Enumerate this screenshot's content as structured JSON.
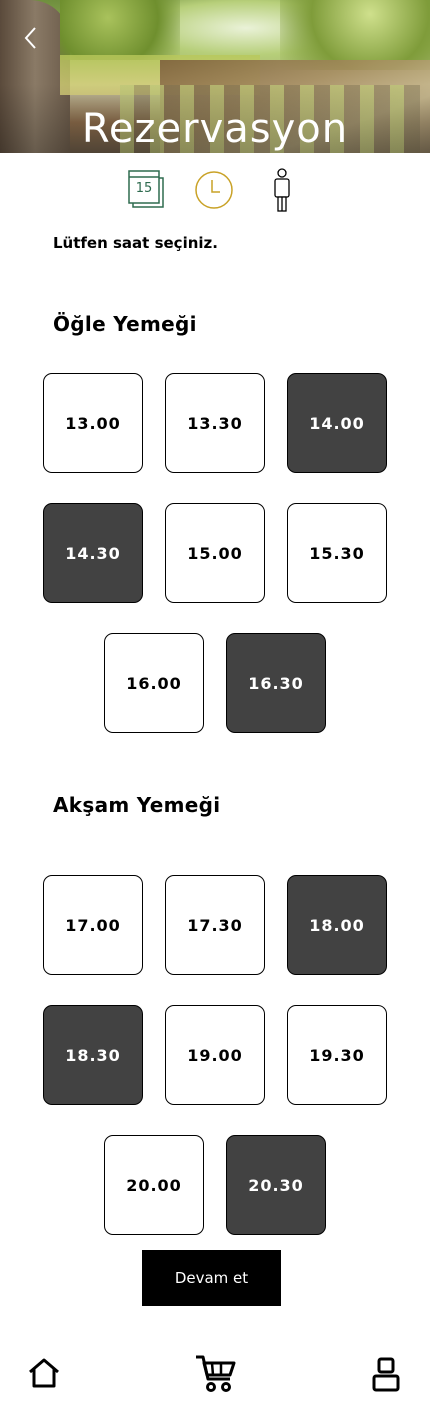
{
  "header": {
    "title": "Rezervasyon"
  },
  "steps": {
    "date_day": "15"
  },
  "instruction": "Lütfen saat seçiniz.",
  "sections": [
    {
      "title": "Öğle Yemeği",
      "slots": [
        {
          "time": "13.00",
          "status": "available"
        },
        {
          "time": "13.30",
          "status": "available"
        },
        {
          "time": "14.00",
          "status": "unavailable"
        },
        {
          "time": "14.30",
          "status": "unavailable"
        },
        {
          "time": "15.00",
          "status": "available"
        },
        {
          "time": "15.30",
          "status": "available"
        },
        {
          "time": "16.00",
          "status": "available"
        },
        {
          "time": "16.30",
          "status": "unavailable"
        }
      ]
    },
    {
      "title": "Akşam Yemeği",
      "slots": [
        {
          "time": "17.00",
          "status": "available"
        },
        {
          "time": "17.30",
          "status": "available"
        },
        {
          "time": "18.00",
          "status": "unavailable"
        },
        {
          "time": "18.30",
          "status": "unavailable"
        },
        {
          "time": "19.00",
          "status": "available"
        },
        {
          "time": "19.30",
          "status": "available"
        },
        {
          "time": "20.00",
          "status": "available"
        },
        {
          "time": "20.30",
          "status": "unavailable"
        }
      ]
    }
  ],
  "continue_button": {
    "label": "Devam et"
  },
  "bottom_nav": [
    "home-icon",
    "cart-icon",
    "profile-icon"
  ],
  "colors": {
    "accent_green": "#2e6b4f",
    "accent_gold": "#c9a227",
    "slot_unavailable": "#424242"
  }
}
